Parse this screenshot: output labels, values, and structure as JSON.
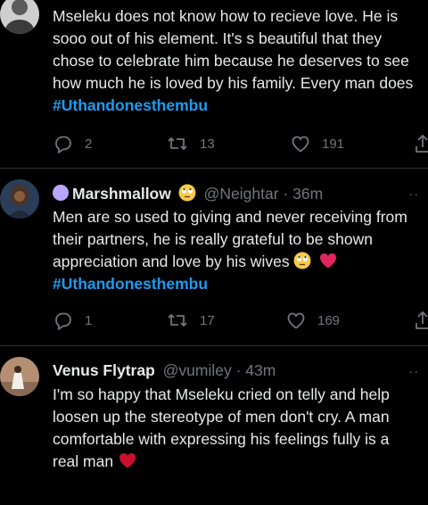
{
  "tweets": [
    {
      "author_name": "",
      "handle": "",
      "time": "",
      "lines": [
        "Mseleku does not know how to recieve love. He is",
        "sooo out of his element. It's s beautiful that they",
        "chose to celebrate him because he deserves to see",
        "how much he is loved by his family. Every man does"
      ],
      "hashtag": "#Uthandonesthembu",
      "replies": "2",
      "retweets": "13",
      "likes": "191"
    },
    {
      "author_name": "Marshmallow",
      "handle": "@Neightar",
      "time": "· 36m",
      "lines": [
        "Men are so used to giving and never receiving from",
        "their partners, he is really grateful to be shown",
        "appreciation and love by his wives"
      ],
      "hashtag": "#Uthandonesthembu",
      "replies": "1",
      "retweets": "17",
      "likes": "169"
    },
    {
      "author_name": "Venus Flytrap",
      "handle": "@vumiley",
      "time": "· 43m",
      "lines": [
        "I'm so happy that Mseleku cried on telly and help",
        "loosen up the stereotype of men don't cry. A man",
        "comfortable with expressing his feelings fully is a",
        "real man"
      ]
    }
  ],
  "colors": {
    "background": "#000000",
    "text": "#e7e9ea",
    "muted": "#71767b",
    "hashtag": "#1d9bf0",
    "heart": "#e0245e",
    "divider": "#2f3336"
  },
  "icons": [
    "reply-icon",
    "retweet-icon",
    "like-icon",
    "share-icon",
    "more-icon",
    "heart-emoji",
    "rolling-eyes-emoji"
  ]
}
